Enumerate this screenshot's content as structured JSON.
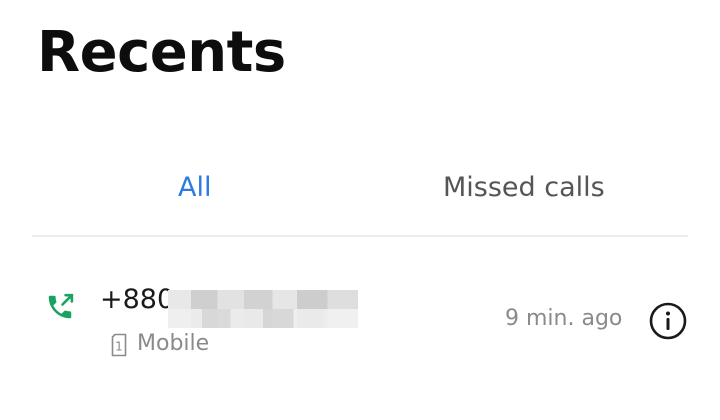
{
  "header": {
    "title": "Recents"
  },
  "tabs": [
    {
      "label": "All",
      "selected": true
    },
    {
      "label": "Missed calls",
      "selected": false
    }
  ],
  "colors": {
    "accent": "#2d7be0",
    "call_icon": "#1aa260",
    "secondary_text": "#8a8a8a"
  },
  "calls": [
    {
      "number": "+880",
      "line_type": "Mobile",
      "sim_slot": "1",
      "time": "9 min. ago",
      "direction_icon": "outgoing-call-icon",
      "info_icon": "info-icon"
    }
  ]
}
